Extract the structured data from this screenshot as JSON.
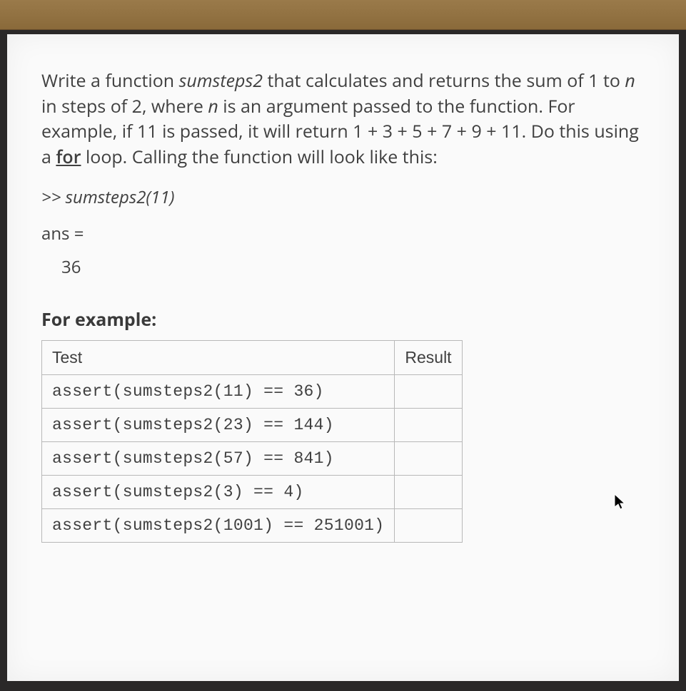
{
  "problem": {
    "pre1": "Write a function ",
    "fn": "sumsteps2",
    "mid1": " that calculates and returns the sum of 1 to ",
    "var1": "n",
    "mid2": " in steps of 2, where ",
    "var2": "n",
    "mid3": " is an argument passed to the function.  For example, if 11 is passed, it will return 1 + 3 + 5 + 7 + 9 + 11.  Do this using a ",
    "kw": "for",
    "post": " loop.  Calling the function will look like this:"
  },
  "call_example": ">> sumsteps2(11)",
  "ans_label": "ans =",
  "ans_value": "36",
  "for_example_label": "For example:",
  "table": {
    "headers": [
      "Test",
      "Result"
    ],
    "rows": [
      {
        "test": "assert(sumsteps2(11) == 36)",
        "result": ""
      },
      {
        "test": "assert(sumsteps2(23) == 144)",
        "result": ""
      },
      {
        "test": "assert(sumsteps2(57) == 841)",
        "result": ""
      },
      {
        "test": "assert(sumsteps2(3) == 4)",
        "result": ""
      },
      {
        "test": "assert(sumsteps2(1001) == 251001)",
        "result": ""
      }
    ]
  }
}
